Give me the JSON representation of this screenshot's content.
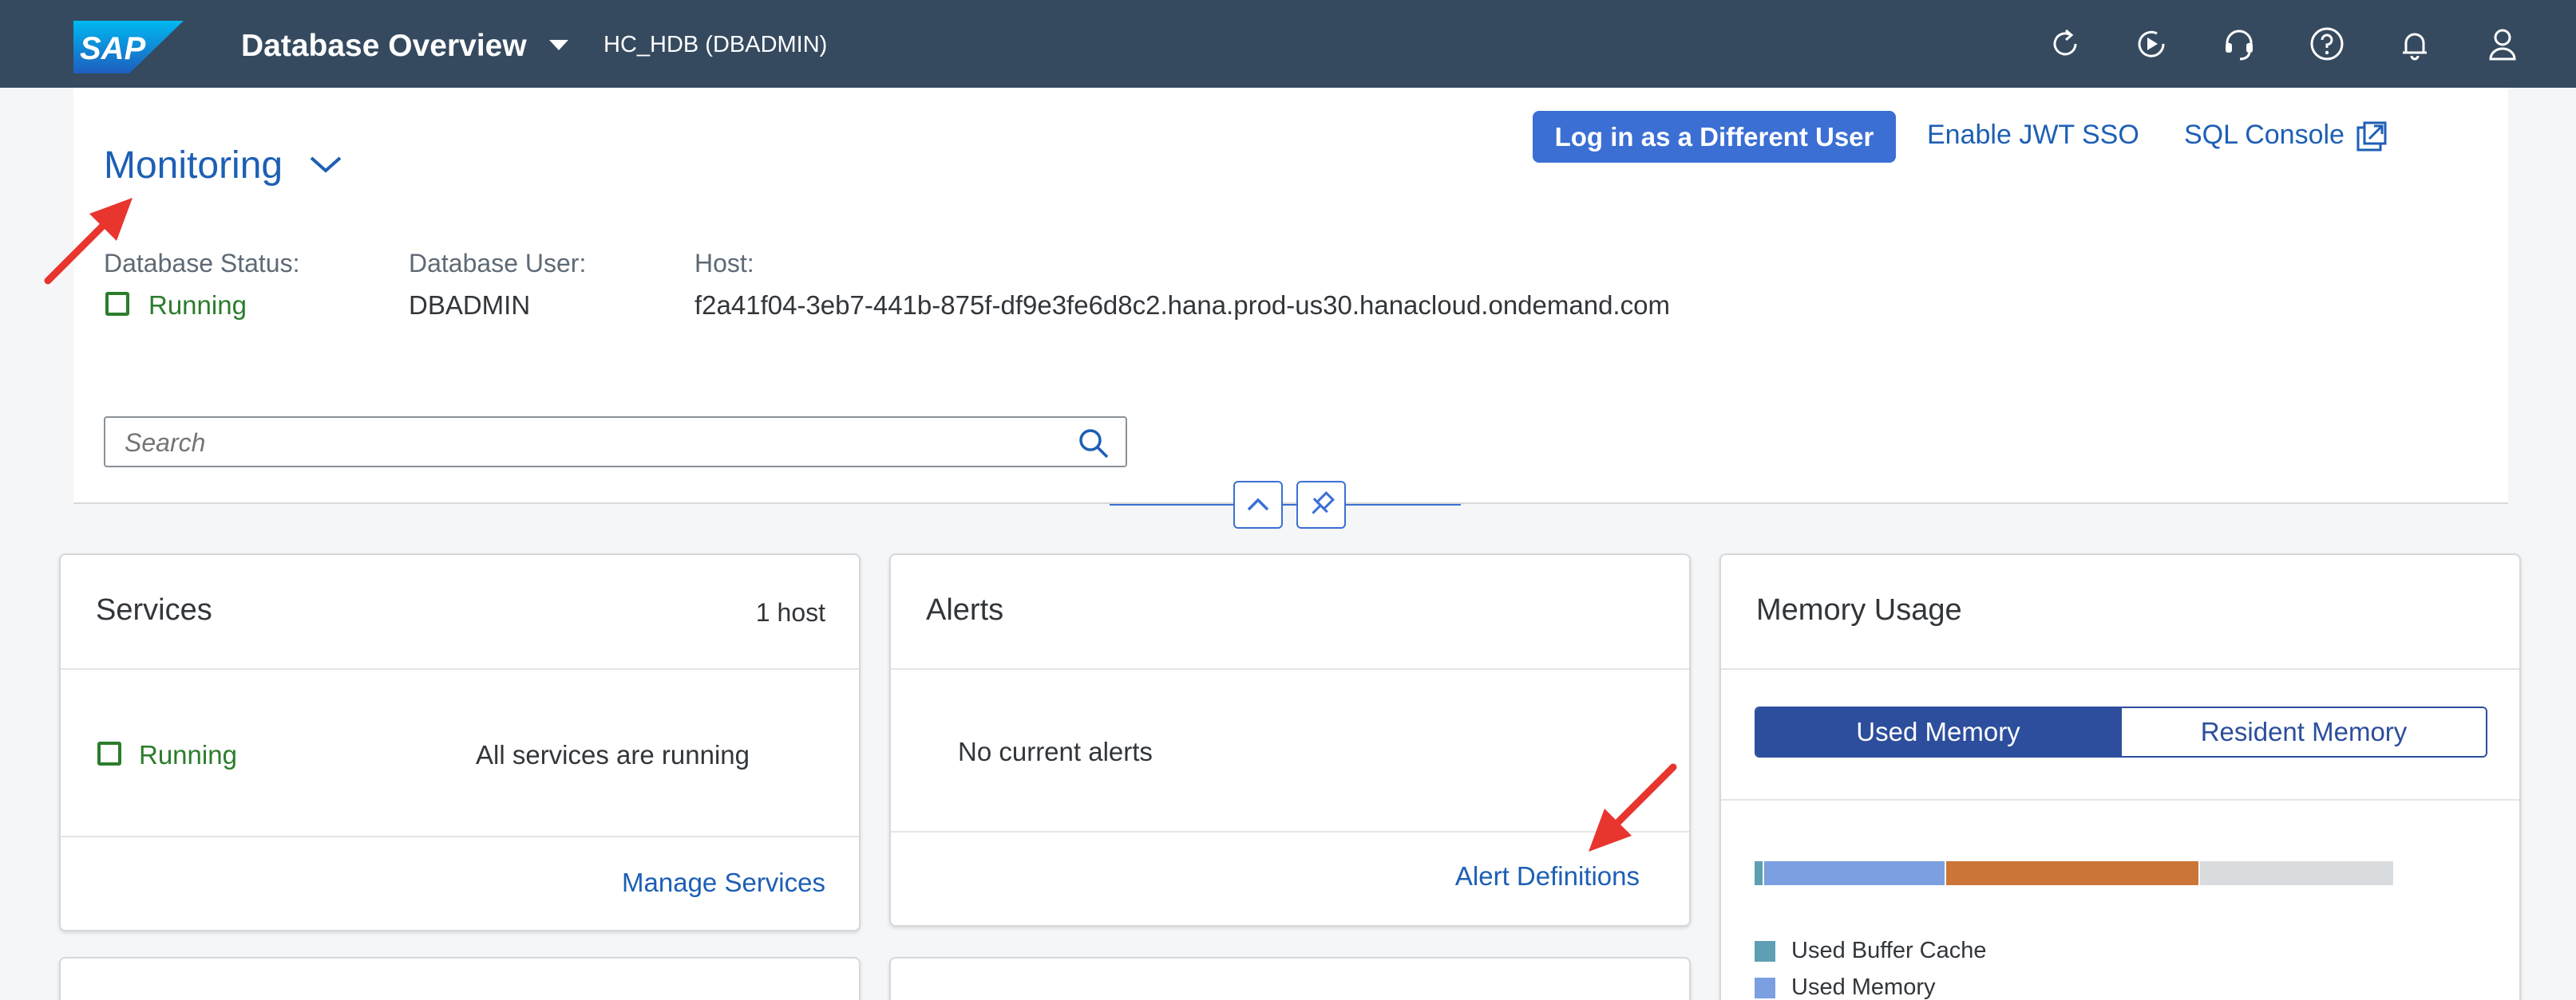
{
  "shell": {
    "logo_text": "SAP",
    "app_title": "Database Overview",
    "connection": "HC_HDB (DBADMIN)",
    "icons": [
      "refresh-icon",
      "play-circle-icon",
      "headset-icon",
      "help-icon",
      "bell-icon",
      "user-icon"
    ]
  },
  "header": {
    "title": "Monitoring",
    "actions": {
      "login_other": "Log in as a Different User",
      "enable_jwt": "Enable JWT SSO",
      "sql_console": "SQL Console"
    },
    "attributes": {
      "status_label": "Database Status:",
      "status_value": "Running",
      "user_label": "Database User:",
      "user_value": "DBADMIN",
      "host_label": "Host:",
      "host_value": "f2a41f04-3eb7-441b-875f-df9e3fe6d8c2.hana.prod-us30.hanacloud.ondemand.com"
    },
    "search_placeholder": "Search"
  },
  "cards": {
    "services": {
      "title": "Services",
      "subtitle": "1 host",
      "status": "Running",
      "message": "All services are running",
      "link": "Manage Services"
    },
    "alerts": {
      "title": "Alerts",
      "message": "No current alerts",
      "link": "Alert Definitions"
    },
    "memory": {
      "title": "Memory Usage",
      "tabs": [
        "Used Memory",
        "Resident Memory"
      ],
      "selected_tab": "Used Memory",
      "usage_fractions": {
        "used_buffer_cache": 0.013,
        "used_memory": 0.285,
        "other": 0.397,
        "free": 0.305
      },
      "legend": [
        "Used Buffer Cache",
        "Used Memory"
      ],
      "colors": {
        "buffer_cache": "#5ea0b3",
        "used_memory": "#7b9fe0",
        "other": "#cc7538",
        "free": "#d9dcdf"
      }
    }
  },
  "colors": {
    "shell": "#354a5f",
    "accent": "#3b6fd4",
    "positive": "#2b7d2b",
    "annotation_arrow": "#e8352e"
  }
}
